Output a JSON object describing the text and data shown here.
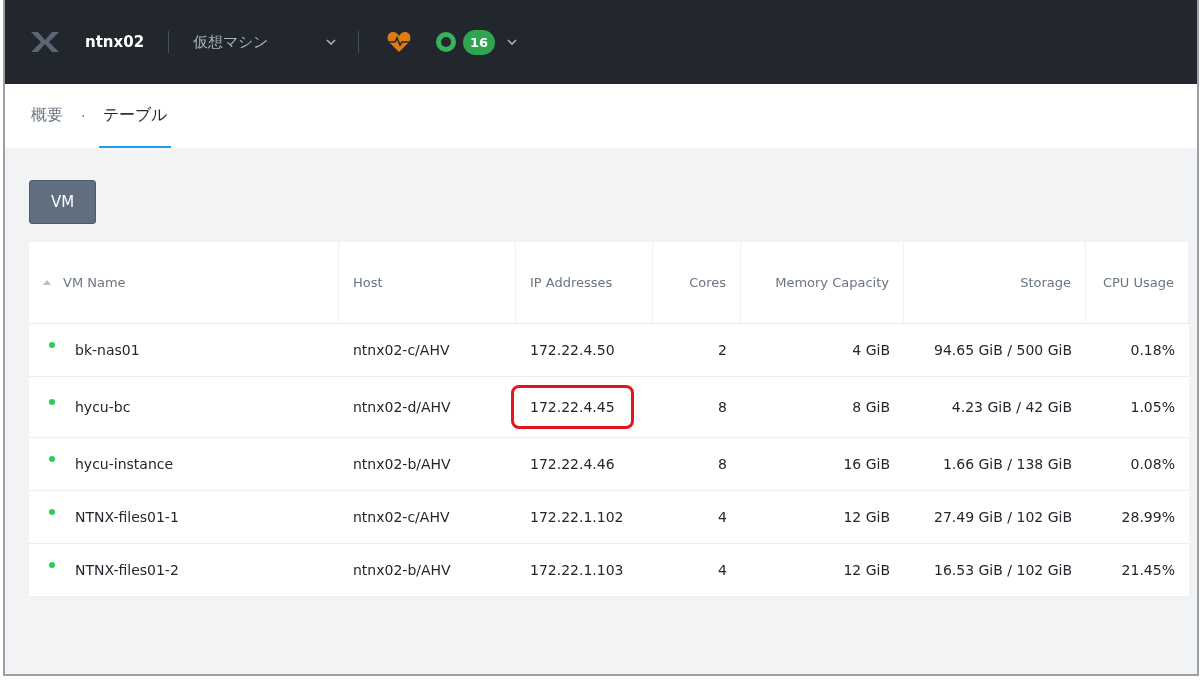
{
  "header": {
    "cluster": "ntnx02",
    "section": "仮想マシン",
    "alert_count": "16"
  },
  "tabs": [
    {
      "label": "概要",
      "selected": false
    },
    {
      "label": "テーブル",
      "selected": true
    }
  ],
  "tab_separator": "·",
  "view_button": "VM",
  "table": {
    "columns": [
      {
        "label": "VM Name",
        "sorted": true
      },
      {
        "label": "Host",
        "sorted": false
      },
      {
        "label": "IP Addresses",
        "sorted": false
      },
      {
        "label": "Cores",
        "sorted": false
      },
      {
        "label": "Memory Capacity",
        "sorted": false
      },
      {
        "label": "Storage",
        "sorted": false
      },
      {
        "label": "CPU Usage",
        "sorted": false
      }
    ],
    "rows": [
      {
        "color": "#2ecc5a",
        "name": "bk-nas01",
        "host": "ntnx02-c/AHV",
        "ip": "172.22.4.50",
        "ip_highlighted": false,
        "cores": "2",
        "memory": "4 GiB",
        "storage": "94.65 GiB / 500 GiB",
        "cpu": "0.18%"
      },
      {
        "color": "#2ecc5a",
        "name": "hycu-bc",
        "host": "ntnx02-d/AHV",
        "ip": "172.22.4.45",
        "ip_highlighted": true,
        "cores": "8",
        "memory": "8 GiB",
        "storage": "4.23 GiB / 42 GiB",
        "cpu": "1.05%"
      },
      {
        "color": "#2ecc5a",
        "name": "hycu-instance",
        "host": "ntnx02-b/AHV",
        "ip": "172.22.4.46",
        "ip_highlighted": false,
        "cores": "8",
        "memory": "16 GiB",
        "storage": "1.66 GiB / 138 GiB",
        "cpu": "0.08%"
      },
      {
        "color": "#2ecc5a",
        "name": "NTNX-files01-1",
        "host": "ntnx02-c/AHV",
        "ip": "172.22.1.102",
        "ip_highlighted": false,
        "cores": "4",
        "memory": "12 GiB",
        "storage": "27.49 GiB / 102 GiB",
        "cpu": "28.99%"
      },
      {
        "color": "#2ecc5a",
        "name": "NTNX-files01-2",
        "host": "ntnx02-b/AHV",
        "ip": "172.22.1.103",
        "ip_highlighted": false,
        "cores": "4",
        "memory": "12 GiB",
        "storage": "16.53 GiB / 102 GiB",
        "cpu": "21.45%"
      }
    ]
  }
}
